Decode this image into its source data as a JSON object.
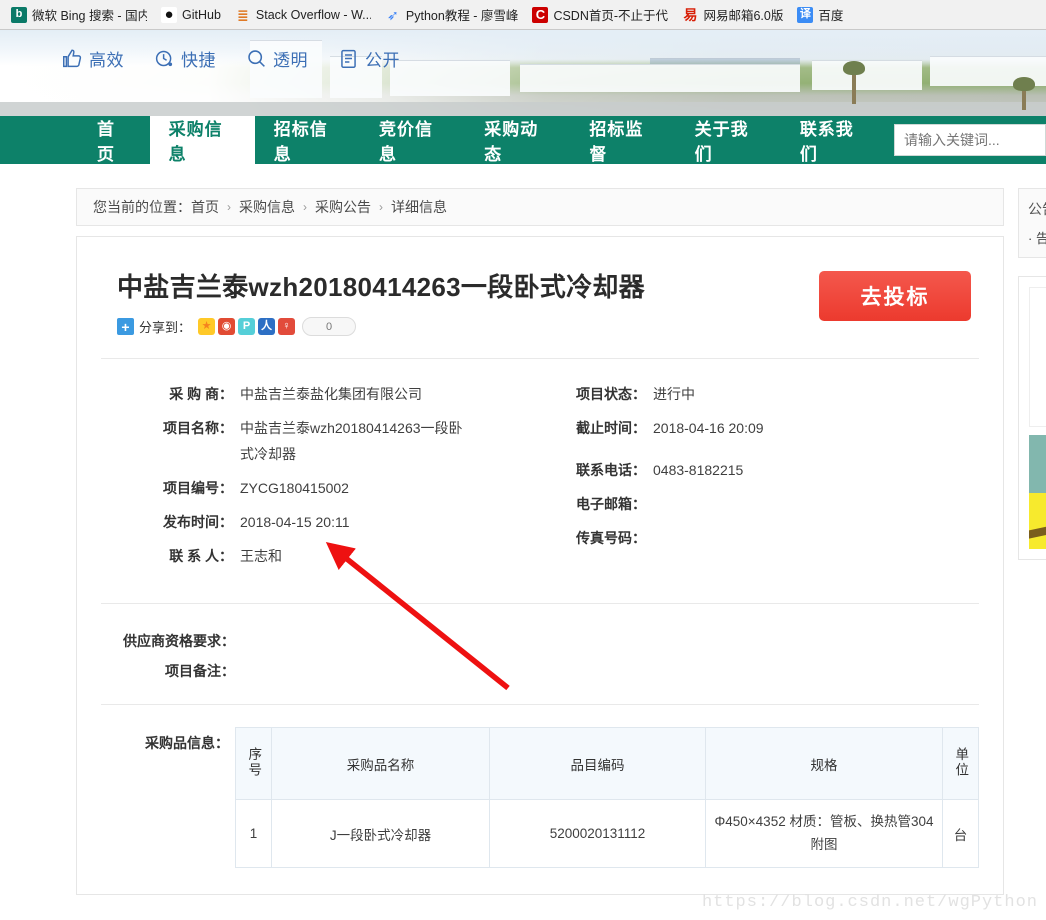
{
  "browser": {
    "bookmarks": [
      {
        "label": "微软 Bing 搜索 - 国内版",
        "icon": "bing-icon",
        "glyph": "b"
      },
      {
        "label": "GitHub",
        "icon": "github-icon",
        "glyph": "●"
      },
      {
        "label": "Stack Overflow - W...",
        "icon": "stackoverflow-icon",
        "glyph": "≣"
      },
      {
        "label": "Python教程 - 廖雪峰",
        "icon": "python-tutorial-icon",
        "glyph": "➶"
      },
      {
        "label": "CSDN首页-不止于代码",
        "icon": "csdn-icon",
        "glyph": "C"
      },
      {
        "label": "网易邮箱6.0版",
        "icon": "netease-mail-icon",
        "glyph": "易"
      },
      {
        "label": "百度",
        "icon": "translate-icon",
        "glyph": "译"
      }
    ]
  },
  "header": {
    "features": [
      {
        "label": "高效",
        "icon": "thumbs-up-icon"
      },
      {
        "label": "快捷",
        "icon": "clock-icon"
      },
      {
        "label": "透明",
        "icon": "search-icon"
      },
      {
        "label": "公开",
        "icon": "clipboard-icon"
      }
    ]
  },
  "nav": {
    "items": [
      {
        "label": "首页",
        "active": false
      },
      {
        "label": "采购信息",
        "active": true
      },
      {
        "label": "招标信息",
        "active": false
      },
      {
        "label": "竞价信息",
        "active": false
      },
      {
        "label": "采购动态",
        "active": false
      },
      {
        "label": "招标监督",
        "active": false
      },
      {
        "label": "关于我们",
        "active": false
      },
      {
        "label": "联系我们",
        "active": false
      }
    ],
    "search_placeholder": "请输入关键词...",
    "accent_color": "#0d8169"
  },
  "breadcrumb": {
    "prefix": "您当前的位置：",
    "items": [
      "首页",
      "采购信息",
      "采购公告",
      "详细信息"
    ],
    "separator": "›"
  },
  "detail": {
    "title": "中盐吉兰泰wzh20180414263一段卧式冷却器",
    "share": {
      "plus": "+",
      "label": "分享到：",
      "icons": [
        {
          "name": "qzone-share-icon",
          "glyph": "★"
        },
        {
          "name": "weibo-share-icon",
          "glyph": "◉"
        },
        {
          "name": "pengyou-share-icon",
          "glyph": "P"
        },
        {
          "name": "renren-share-icon",
          "glyph": "人"
        },
        {
          "name": "douban-share-icon",
          "glyph": "♀"
        }
      ],
      "count": "0"
    },
    "bid_button": "去投标",
    "bid_button_color": "#ef4136",
    "fields_left": [
      {
        "key": "采 购 商：",
        "value": "中盐吉兰泰盐化集团有限公司"
      },
      {
        "key": "项目名称：",
        "value": "中盐吉兰泰wzh20180414263一段卧式冷却器"
      },
      {
        "key": "项目编号：",
        "value": "ZYCG180415002"
      },
      {
        "key": "发布时间：",
        "value": "2018-04-15  20:11"
      },
      {
        "key": "联 系 人：",
        "value": "王志和"
      }
    ],
    "fields_right": [
      {
        "key": "项目状态：",
        "value": "进行中"
      },
      {
        "key": "截止时间：",
        "value": "2018-04-16  20:09"
      },
      {
        "key": "",
        "value": ""
      },
      {
        "key": "联系电话：",
        "value": "0483-8182215"
      },
      {
        "key": "电子邮箱：",
        "value": ""
      },
      {
        "key": "传真号码：",
        "value": ""
      }
    ],
    "qualification": [
      {
        "key": "供应商资格要求：",
        "value": ""
      },
      {
        "key": "项目备注：",
        "value": ""
      }
    ],
    "products_label": "采购品信息：",
    "products_table": {
      "columns": [
        "序号",
        "采购品名称",
        "品目编码",
        "规格",
        "单位"
      ],
      "rows": [
        {
          "index": "1",
          "name": "J一段卧式冷却器",
          "code": "5200020131112",
          "spec": "Φ450×4352 材质：管板、换热管304 附图",
          "unit": "台"
        }
      ]
    }
  },
  "sidebar": {
    "panel_title": "公告",
    "panel_items": [
      "· 告"
    ]
  },
  "watermark": "https://blog.csdn.net/wgPython"
}
